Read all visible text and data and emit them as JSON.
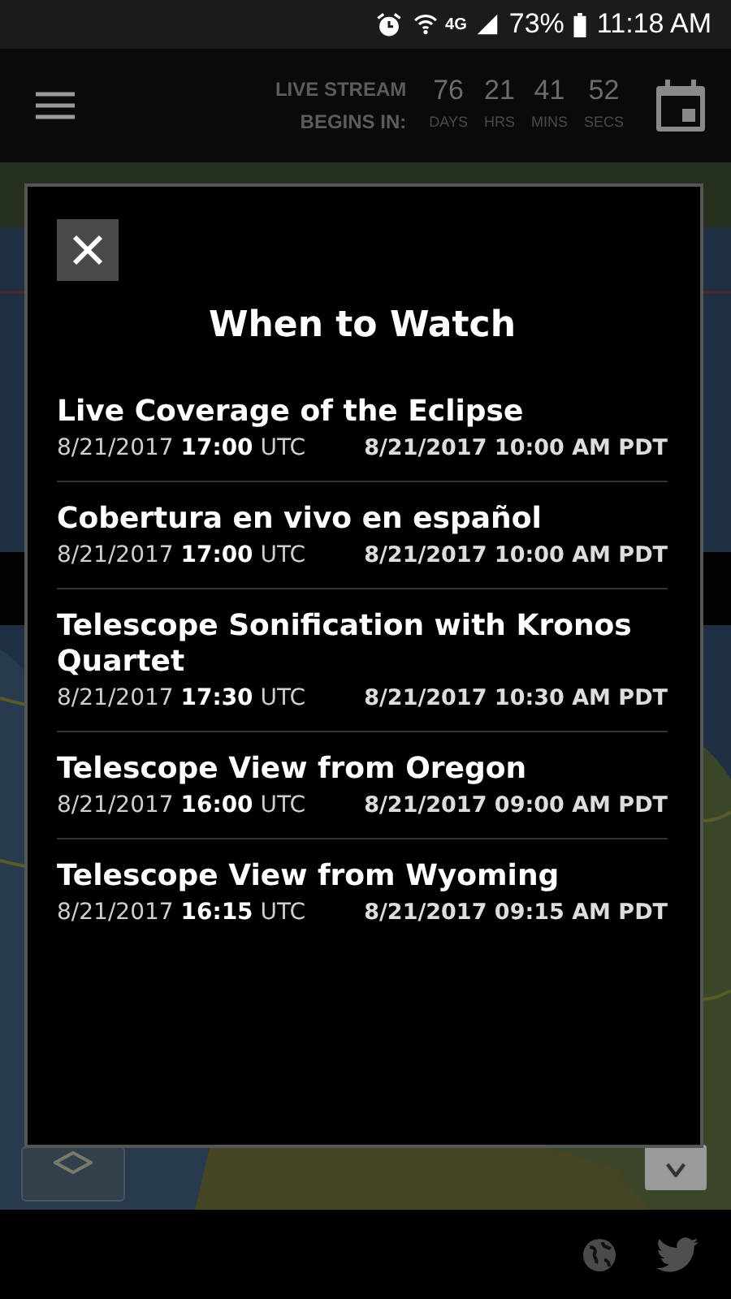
{
  "status_bar": {
    "network": "4G",
    "battery": "73%",
    "time": "11:18 AM"
  },
  "header": {
    "countdown_label": [
      "LIVE STREAM",
      "BEGINS IN:"
    ],
    "countdown": [
      {
        "value": "76",
        "unit": "DAYS"
      },
      {
        "value": "21",
        "unit": "HRS"
      },
      {
        "value": "41",
        "unit": "MINS"
      },
      {
        "value": "52",
        "unit": "SECS"
      }
    ]
  },
  "dialog": {
    "title": "When to Watch",
    "events": [
      {
        "title": "Live Coverage of the Eclipse",
        "utc": "8/21/2017 **17:00** UTC",
        "local": "8/21/2017 10:00 AM PDT"
      },
      {
        "title": "Cobertura en vivo en español",
        "utc": "8/21/2017 **17:00** UTC",
        "local": "8/21/2017 10:00 AM PDT"
      },
      {
        "title": "Telescope Sonification with Kronos Quartet",
        "utc": "8/21/2017 **17:30** UTC",
        "local": "8/21/2017 10:30 AM PDT"
      },
      {
        "title": "Telescope View from Oregon",
        "utc": "8/21/2017 **16:00** UTC",
        "local": "8/21/2017 09:00 AM PDT"
      },
      {
        "title": "Telescope View from Wyoming",
        "utc": "8/21/2017 **16:15** UTC",
        "local": "8/21/2017 09:15 AM PDT"
      }
    ]
  }
}
